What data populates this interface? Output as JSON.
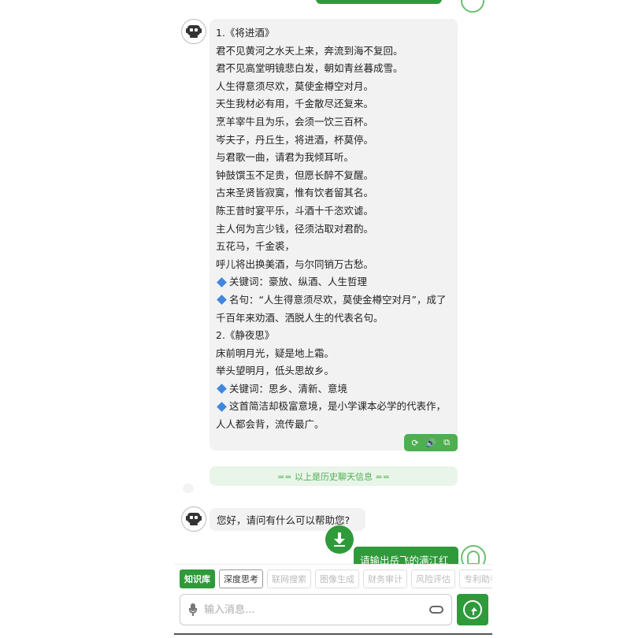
{
  "poem_message": {
    "lines": [
      "1.《将进酒》",
      "君不见黄河之水天上来，奔流到海不复回。",
      "君不见高堂明镜悲白发，朝如青丝暮成雪。",
      "人生得意须尽欢，莫使金樽空对月。",
      "天生我材必有用，千金散尽还复来。",
      "烹羊宰牛且为乐，会须一饮三百杯。",
      "岑夫子，丹丘生，将进酒，杯莫停。",
      "与君歌一曲，请君为我倾耳听。",
      "钟鼓馔玉不足贵，但愿长醉不复醒。",
      "古来圣贤皆寂寞，惟有饮者留其名。",
      "陈王昔时宴平乐，斗酒十千恣欢谑。",
      "主人何为言少钱，径须沽取对君酌。",
      "五花马，千金裘，",
      "呼儿将出换美酒，与尔同销万古愁。"
    ],
    "keywords1": "关键词：豪放、纵酒、人生哲理",
    "famous1": "名句：“人生得意须尽欢，莫使金樽空对月”，成了千百年来劝酒、洒脱人生的代表名句。",
    "title2": "2.《静夜思》",
    "lines2": [
      "床前明月光，疑是地上霜。",
      "举头望明月，低头思故乡。"
    ],
    "keywords2": "关键词：思乡、清新、意境",
    "note2": "这首简洁却极富意境，是小学课本必学的代表作，人人都会背，流传最广。"
  },
  "actions": {
    "icons": [
      "refresh-icon",
      "speaker-icon",
      "copy-icon"
    ],
    "glyphs": [
      "⟳",
      "🔊",
      "⧉"
    ]
  },
  "history_divider": "== 以上是历史聊天信息 ==",
  "greeting": "您好，请问有什么可以帮助您?",
  "user_message": "请输出岳飞的满江红",
  "chips": [
    {
      "label": "知识库",
      "state": "active"
    },
    {
      "label": "深度思考",
      "state": "normal"
    },
    {
      "label": "联网搜索",
      "state": "disabled"
    },
    {
      "label": "图像生成",
      "state": "disabled"
    },
    {
      "label": "财务审计",
      "state": "disabled"
    },
    {
      "label": "风险评估",
      "state": "disabled"
    },
    {
      "label": "专利助手",
      "state": "disabled"
    }
  ],
  "input": {
    "placeholder": "输入消息...",
    "value": ""
  },
  "colors": {
    "accent": "#2f9a3a",
    "bubble": "#f2f2f2",
    "diamond": "#3f87e0"
  }
}
